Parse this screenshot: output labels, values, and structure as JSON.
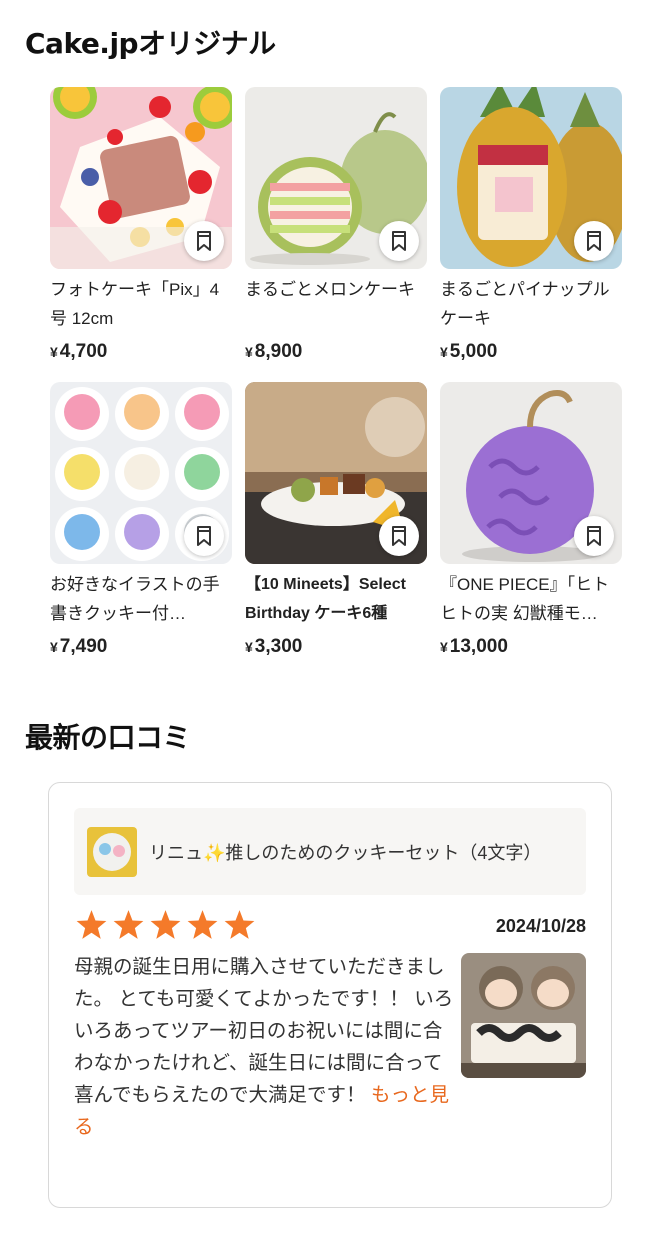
{
  "sections": {
    "original_title": "Cake.jpオリジナル",
    "reviews_title": "最新の口コミ"
  },
  "products": [
    {
      "name": "フォトケーキ「Pix」4号 12cm",
      "yen": "¥",
      "price": "4,700"
    },
    {
      "name": "まるごとメロンケーキ",
      "yen": "¥",
      "price": "8,900"
    },
    {
      "name": "まるごとパイナップルケーキ",
      "yen": "¥",
      "price": "5,000"
    },
    {
      "name": "お好きなイラストの手書きクッキー付…",
      "yen": "¥",
      "price": "7,490"
    },
    {
      "name": "【10 Mineets】Select Birthday ケーキ6種",
      "yen": "¥",
      "price": "3,300"
    },
    {
      "name": "『ONE PIECE』「ヒトヒトの実 幻獣種モ…",
      "yen": "¥",
      "price": "13,000"
    }
  ],
  "review": {
    "product_title": "リニュ✨推しのためのクッキーセット（4文字）",
    "rating": 5,
    "date": "2024/10/28",
    "text": "母親の誕生日用に購入させていただきました。 とても可愛くてよかったです！！ いろいろあってツアー初日のお祝いには間に合わなかったけれど、誕生日には間に合って喜んでもらえたので大満足です！ ",
    "more_label": "もっと見る"
  },
  "colors": {
    "star": "#f47a2a",
    "link": "#e8681e"
  },
  "icons": {
    "bookmark": "bookmark-icon",
    "star": "star-icon"
  }
}
